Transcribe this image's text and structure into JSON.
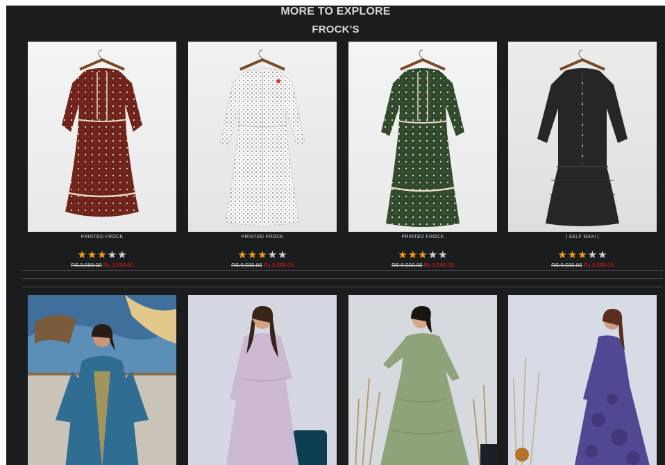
{
  "section": {
    "title": "MORE TO EXPLORE",
    "category": "FROCK'S"
  },
  "colors": {
    "background": "#1b1c1e",
    "star_filled": "#f39c12",
    "star_empty": "#cfcfcf",
    "sale_price": "#e01818"
  },
  "products": [
    {
      "name": "PRINTED FROCK",
      "rating": 3,
      "max_rating": 5,
      "old_price": "RS.9,500.00",
      "new_price": "Rs.3,599.00"
    },
    {
      "name": "PRINTED FROCK",
      "rating": 3,
      "max_rating": 5,
      "old_price": "RS.9,500.00",
      "new_price": "Rs.3,599.00"
    },
    {
      "name": "PRINTED FROCK",
      "rating": 3,
      "max_rating": 5,
      "old_price": "RS.9,500.00",
      "new_price": "Rs.3,599.00"
    },
    {
      "name": "| SELF MAXI |",
      "rating": 3,
      "max_rating": 5,
      "old_price": "RS.9,500.00",
      "new_price": "Rs.3,599.00"
    }
  ],
  "star_glyphs": {
    "filled": "★",
    "empty": "★"
  }
}
